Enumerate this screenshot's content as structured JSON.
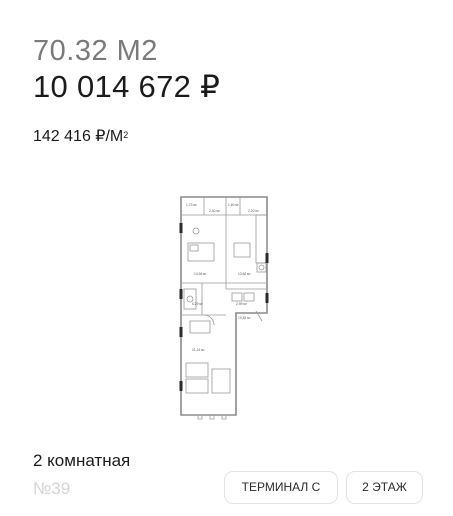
{
  "listing": {
    "area": "70.32 М2",
    "price": "10 014 672 ₽",
    "price_per_m_value": "142 416 ₽/М",
    "price_per_m_sup": "2",
    "rooms": "2 комнатная",
    "number": "№39"
  },
  "tags": {
    "building": "ТЕРМИНАЛ С",
    "floor": "2 ЭТАЖ"
  },
  "floorplan": {
    "room_areas": [
      "1,73 м²",
      "2,40 м²",
      "1,60 м²",
      "2,20 м²",
      "14,94 м²",
      "13,62 м²",
      "6,29 м²",
      "2,99 м²",
      "10,53 м²",
      "21,14 м²"
    ]
  },
  "colors": {
    "text": "#1b1b1b",
    "muted": "#7a7a7a",
    "faint": "#d4d4d4",
    "border": "#e3e3e3"
  }
}
